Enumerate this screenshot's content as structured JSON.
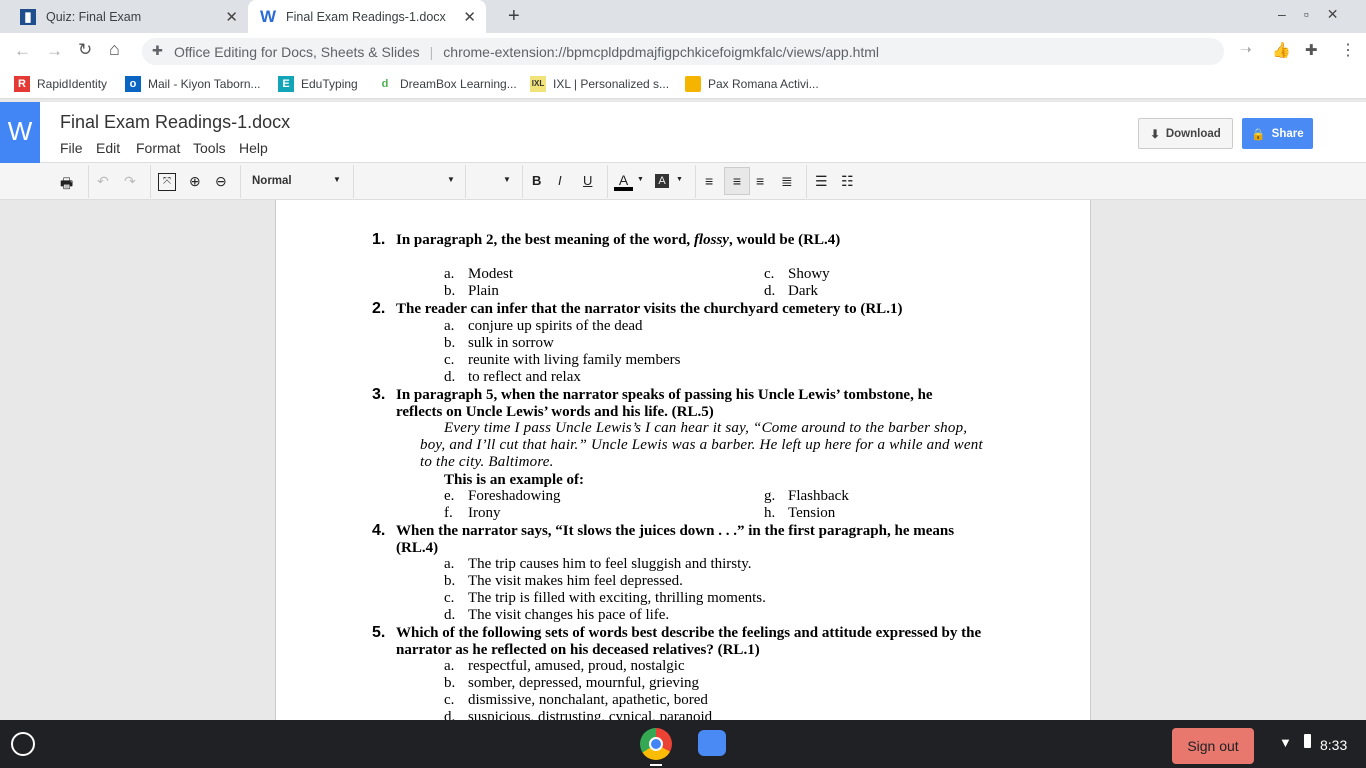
{
  "browser": {
    "tabs": [
      {
        "title": "Quiz: Final Exam",
        "active": false
      },
      {
        "title": "Final Exam Readings-1.docx",
        "active": true
      }
    ],
    "omnibox": {
      "site": "Office Editing for Docs, Sheets & Slides",
      "url": "chrome-extension://bpmcpldpdmajfigpchkicefoigmkfalc/views/app.html"
    },
    "bookmarks": [
      "RapidIdentity",
      "Mail - Kiyon Taborn...",
      "EduTyping",
      "DreamBox Learning...",
      "IXL | Personalized s...",
      "Pax Romana Activi..."
    ]
  },
  "app": {
    "logo": "W",
    "title": "Final Exam Readings-1.docx",
    "menu": [
      "File",
      "Edit",
      "Format",
      "Tools",
      "Help"
    ],
    "download": "Download",
    "share": "Share",
    "toolbar": {
      "style": "Normal",
      "bold": "B",
      "italic": "I",
      "underline": "U",
      "font_color": "A",
      "highlight": "A"
    }
  },
  "document": {
    "questions": [
      {
        "num": "1.",
        "lines": [
          [
            "In paragraph 2, the best meaning of the word, ",
            "flossy",
            ", would be (RL.4)"
          ]
        ],
        "grid": [
          [
            "a.",
            "Modest",
            "c.",
            "Showy"
          ],
          [
            "b.",
            "Plain",
            "d.",
            "Dark"
          ]
        ]
      },
      {
        "num": "2.",
        "lines": [
          [
            " The reader can infer that the narrator visits the churchyard cemetery to (RL.1)"
          ]
        ],
        "options": [
          [
            "a.",
            "conjure up spirits of the dead"
          ],
          [
            "b.",
            "sulk in sorrow"
          ],
          [
            "c.",
            "reunite with living family members"
          ],
          [
            "d.",
            "to reflect and relax"
          ]
        ]
      },
      {
        "num": "3.",
        "lines": [
          [
            "In paragraph 5, when the narrator speaks of passing his Uncle Lewis’ tombstone, he"
          ],
          [
            "reflects on Uncle Lewis’ words and his life. (RL.5)"
          ]
        ],
        "quote": [
          "Every time I pass Uncle Lewis’s I can hear it say, “Come around to the barber shop,",
          "boy, and I’ll cut that hair.” Uncle Lewis was a barber. He left up here for a while and went",
          "to the city. Baltimore."
        ],
        "prompt": "This is an example of:",
        "grid": [
          [
            "e.",
            "Foreshadowing",
            "g.",
            "Flashback"
          ],
          [
            "f.",
            "Irony",
            "h.",
            "Tension"
          ]
        ]
      },
      {
        "num": "4.",
        "lines": [
          [
            "When the narrator says, “It slows the juices down . . .” in the first paragraph, he means"
          ],
          [
            "(RL.4)"
          ]
        ],
        "options": [
          [
            "a.",
            "The trip causes him to feel sluggish and thirsty."
          ],
          [
            "b.",
            "The visit makes him feel depressed."
          ],
          [
            "c.",
            "The trip is filled with exciting, thrilling moments."
          ],
          [
            "d.",
            "The visit changes his pace of life."
          ]
        ]
      },
      {
        "num": "5.",
        "lines": [
          [
            "Which of the following sets of words best describe the feelings and attitude expressed by the"
          ],
          [
            "narrator as he reflected on his deceased relatives? (RL.1)"
          ]
        ],
        "options": [
          [
            "a.",
            "respectful, amused, proud, nostalgic"
          ],
          [
            "b.",
            "somber, depressed, mournful, grieving"
          ],
          [
            "c.",
            "dismissive, nonchalant, apathetic, bored"
          ],
          [
            "d.",
            "suspicious, distrusting, cynical, paranoid"
          ]
        ]
      }
    ]
  },
  "taskbar": {
    "signout": "Sign out",
    "time": "8:33"
  }
}
